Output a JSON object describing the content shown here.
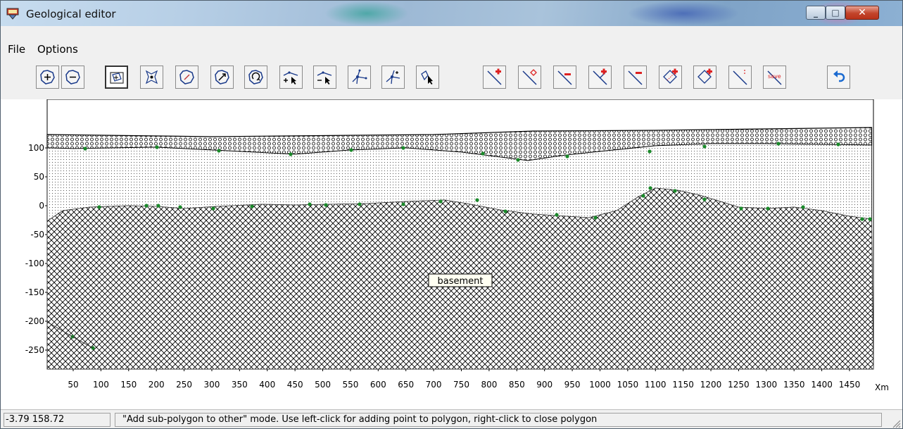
{
  "window": {
    "title": "Geological editor",
    "minimize_glyph": "_",
    "maximize_glyph": "□",
    "close_glyph": "✕"
  },
  "menu": {
    "file": "File",
    "options": "Options"
  },
  "toolbar": {
    "buttons": [
      "add-polygon-icon",
      "remove-polygon-icon",
      "add-sub-polygon-icon",
      "split-polygon-icon",
      "edit-polygon-icon",
      "move-polygon-icon",
      "rotate-polygon-icon",
      "add-point-icon",
      "remove-point-icon",
      "move-point-icon",
      "move-node-icon",
      "select-node-icon",
      "add-line-icon",
      "edit-line-icon",
      "delete-line-segment-icon",
      "add-line-point-icon",
      "remove-line-point-icon",
      "add-line-polygon-icon",
      "add-line-polygon-alt-icon",
      "line-icon",
      "save-lines-icon",
      "undo-icon"
    ],
    "save_label": "save"
  },
  "plot": {
    "layer_label": "basement",
    "x_unit": "Xm",
    "y_ticks": [
      "100",
      "50",
      "0",
      "-50",
      "-100",
      "-150",
      "-200",
      "-250"
    ],
    "x_ticks": [
      "50",
      "100",
      "150",
      "200",
      "250",
      "300",
      "350",
      "400",
      "450",
      "500",
      "550",
      "600",
      "650",
      "700",
      "750",
      "800",
      "850",
      "900",
      "950",
      "1000",
      "1050",
      "1100",
      "1150",
      "1200",
      "1250",
      "1300",
      "1350",
      "1400",
      "1450"
    ]
  },
  "status": {
    "coords": "-3.79 158.72",
    "message": "\"Add sub-polygon to other\" mode. Use left-click for adding point to polygon, right-click to close polygon"
  }
}
